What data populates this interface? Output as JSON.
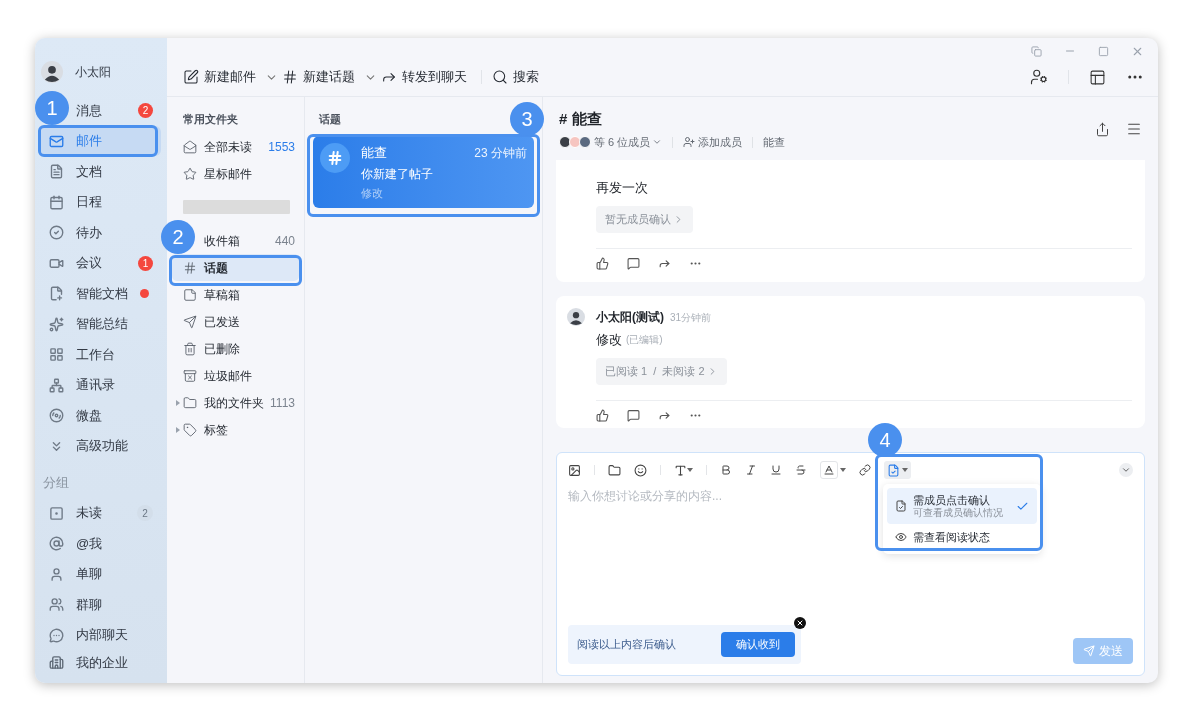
{
  "user": {
    "name": "小太阳"
  },
  "nav": [
    {
      "label": "消息",
      "selected": false,
      "badge": {
        "kind": "alert",
        "text": "2"
      }
    },
    {
      "label": "邮件",
      "selected": true
    },
    {
      "label": "文档",
      "selected": false
    },
    {
      "label": "日程",
      "selected": false
    },
    {
      "label": "待办",
      "selected": false
    },
    {
      "label": "会议",
      "selected": false,
      "badge": {
        "kind": "alert",
        "text": "1"
      }
    },
    {
      "label": "智能文档",
      "selected": false,
      "badge": {
        "kind": "dot"
      }
    },
    {
      "label": "智能总结",
      "selected": false
    },
    {
      "label": "工作台",
      "selected": false
    },
    {
      "label": "通讯录",
      "selected": false
    },
    {
      "label": "微盘",
      "selected": false
    },
    {
      "label": "高级功能",
      "selected": false
    }
  ],
  "group_heading": "分组",
  "groups": [
    {
      "label": "未读",
      "selected": false,
      "badge": {
        "kind": "muted",
        "text": "2"
      }
    },
    {
      "label": "@我",
      "selected": false
    },
    {
      "label": "单聊",
      "selected": false
    },
    {
      "label": "群聊",
      "selected": false
    },
    {
      "label": "内部聊天",
      "selected": false
    }
  ],
  "footer": {
    "label": "我的企业"
  },
  "toolbar": [
    {
      "label": "新建邮件",
      "dropdown": true
    },
    {
      "label": "新建话题",
      "dropdown": true
    },
    {
      "label": "转发到聊天",
      "dropdown": false
    },
    {
      "label": "搜索",
      "dropdown": false
    }
  ],
  "folders": {
    "heading": "常用文件夹",
    "items": [
      {
        "kind": "folder",
        "label": "全部未读",
        "count": "1553",
        "count_highlight": true,
        "selected": false
      },
      {
        "kind": "folder",
        "label": "星标邮件",
        "selected": false
      },
      {
        "kind": "redacted"
      },
      {
        "kind": "folder",
        "label": "收件箱",
        "count": "440",
        "count_highlight": false,
        "selected": false
      },
      {
        "kind": "folder",
        "label": "话题",
        "selected": true
      },
      {
        "kind": "folder",
        "label": "草稿箱",
        "selected": false
      },
      {
        "kind": "folder",
        "label": "已发送",
        "selected": false
      },
      {
        "kind": "folder",
        "label": "已删除",
        "selected": false
      },
      {
        "kind": "folder",
        "label": "垃圾邮件",
        "selected": false
      },
      {
        "kind": "tree",
        "label": "我的文件夹",
        "count": "1113",
        "count_highlight": false,
        "selected": false
      },
      {
        "kind": "tree",
        "label": "标签",
        "selected": false
      }
    ]
  },
  "topics": {
    "heading": "话题",
    "items": [
      {
        "title": "能查",
        "time": "23 分钟前",
        "subtitle": "你新建了帖子",
        "preview": "修改",
        "selected": true
      }
    ]
  },
  "thread": {
    "title": "# 能查",
    "members": "等 6 位成员",
    "add_member": "添加成员",
    "tag": "能查",
    "messages": [
      {
        "text": "再发一次",
        "receipt": "暂无成员确认"
      },
      {
        "author": "小太阳(测试)",
        "time": "31分钟前",
        "text": "修改",
        "edited": "(已编辑)",
        "receipt": "已阅读 1  /  未阅读 2"
      }
    ]
  },
  "composer": {
    "placeholder": "输入你想讨论或分享的内容...",
    "menu": [
      {
        "label": "需成员点击确认",
        "sub": "可查看成员确认情况",
        "selected": true
      },
      {
        "label": "需查看阅读状态",
        "selected": false
      }
    ],
    "confirm_text": "阅读以上内容后确认",
    "confirm_button": "确认收到",
    "send": "发送",
    "send_disabled": true
  },
  "callouts": [
    {
      "number": "1"
    },
    {
      "number": "2"
    },
    {
      "number": "3"
    },
    {
      "number": "4"
    }
  ]
}
